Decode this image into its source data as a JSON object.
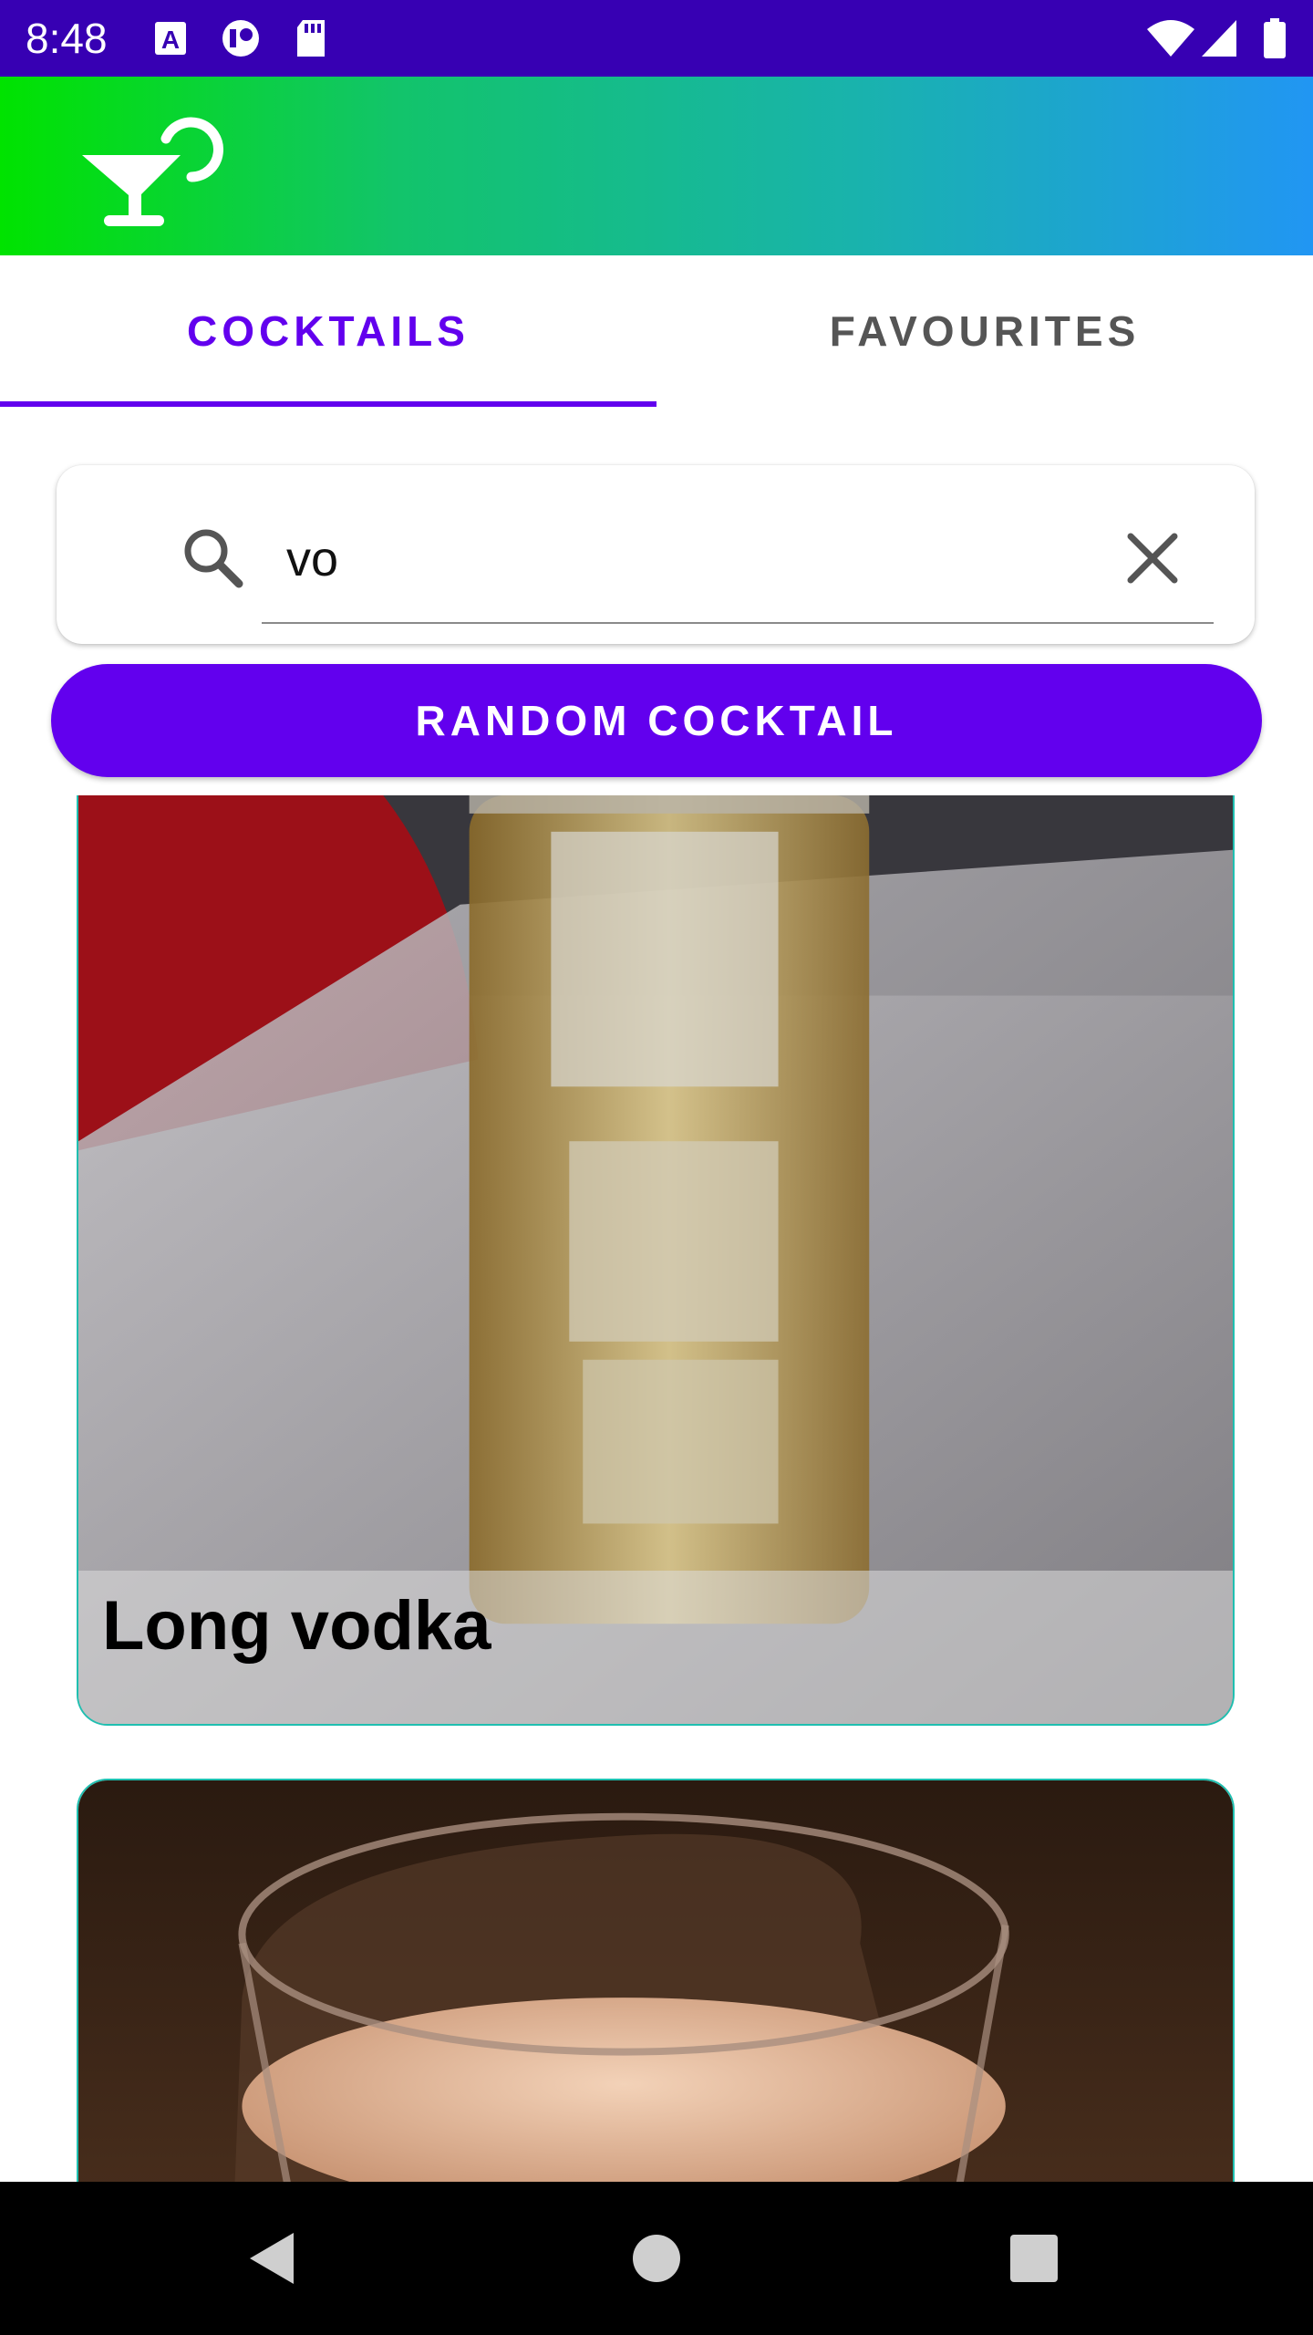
{
  "status_bar": {
    "time": "8:48",
    "icons": [
      "text-a-icon",
      "record-icon",
      "sd-card-icon",
      "wifi-icon",
      "signal-icon",
      "battery-icon"
    ]
  },
  "app_bar": {
    "logo_icon": "cocktail-glass-icon",
    "colors": {
      "gradient_start": "#00e300",
      "gradient_end": "#2196f3"
    }
  },
  "tabs": [
    {
      "label": "COCKTAILS",
      "active": true
    },
    {
      "label": "FAVOURITES",
      "active": false
    }
  ],
  "search": {
    "value": "vo",
    "search_icon": "search-icon",
    "clear_icon": "close-icon"
  },
  "random_button": {
    "label": "RANDOM COCKTAIL"
  },
  "cocktails": [
    {
      "name": "Long vodka"
    },
    {
      "name": ""
    }
  ],
  "nav_bar": {
    "icons": [
      "back-icon",
      "home-icon",
      "recents-icon"
    ]
  },
  "colors": {
    "accent": "#6200ee",
    "status_bar": "#3700b3",
    "card_border": "#1fbfb0"
  }
}
